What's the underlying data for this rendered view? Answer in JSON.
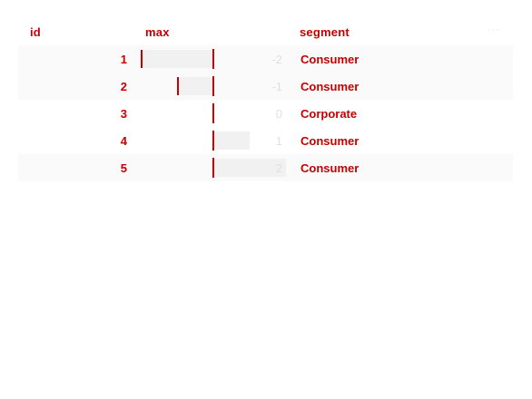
{
  "table": {
    "columns": {
      "id": "id",
      "max": "max",
      "segment": "segment",
      "menu": "···"
    },
    "rows": [
      {
        "id": "1",
        "max": -2,
        "max_label": "-2",
        "segment": "Consumer"
      },
      {
        "id": "2",
        "max": -1,
        "max_label": "-1",
        "segment": "Consumer"
      },
      {
        "id": "3",
        "max": 0,
        "max_label": "0",
        "segment": "Corporate"
      },
      {
        "id": "4",
        "max": 1,
        "max_label": "1",
        "segment": "Consumer"
      },
      {
        "id": "5",
        "max": 2,
        "max_label": "2",
        "segment": "Consumer"
      }
    ],
    "max_range": [
      -2,
      2
    ]
  },
  "colors": {
    "accent": "#c40000",
    "bar_fill": "#f1f1f1",
    "faint_text": "#e0e0e0",
    "alt_row": "#fafafa"
  }
}
